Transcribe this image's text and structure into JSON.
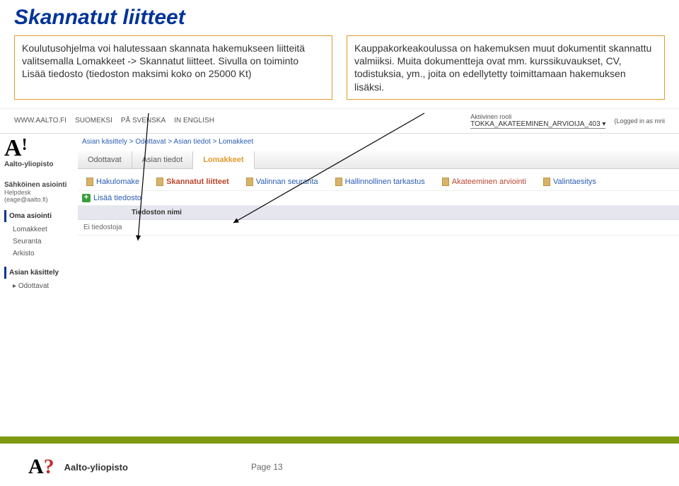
{
  "title": "Skannatut liitteet",
  "callout_left": "Koulutusohjelma voi halutessaan skannata hakemukseen liitteitä valitsemalla Lomakkeet -> Skannatut liitteet. Sivulla on toiminto Lisää tiedosto (tiedoston maksimi koko on 25000 Kt)",
  "callout_right": "Kauppakorkeakoulussa on hakemuksen muut dokumentit skannattu valmiiksi. Muita dokumentteja ovat mm. kurssikuvaukset, CV, todistuksia, ym., joita on edellytetty toimittamaan hakemuksen lisäksi.",
  "toplinks": {
    "url": "WWW.AALTO.FI",
    "langs": [
      "SUOMEKSI",
      "PÅ SVENSKA",
      "IN ENGLISH"
    ],
    "role_label": "Aktiivinen rooli",
    "role_value": "TOKKA_AKATEEMINEN_ARVIOIJA_403",
    "login": "(Logged in as mrii"
  },
  "sidebar": {
    "logo_main": "A",
    "logo_sup": "!",
    "site": "Aalto‑yliopisto",
    "help1": "Sähköinen asiointi",
    "help2": "Helpdesk (eage@aalto.fi)",
    "heads": [
      "Oma asiointi",
      "Asian käsittely"
    ],
    "items_a": [
      "Lomakkeet",
      "Seuranta",
      "Arkisto"
    ],
    "items_b": [
      "Odottavat"
    ]
  },
  "breadcrumb": [
    "Asian käsittely",
    "Odottavat",
    "Asian tiedot",
    "Lomakkeet"
  ],
  "tabs": [
    "Odottavat",
    "Asian tiedot",
    "Lomakkeet"
  ],
  "subtabs": [
    {
      "label": "Hakulomake"
    },
    {
      "label": "Skannatut liitteet"
    },
    {
      "label": "Valinnan seuranta"
    },
    {
      "label": "Hallinnollinen tarkastus"
    },
    {
      "label": "Akateeminen arviointi"
    },
    {
      "label": "Valintaesitys"
    }
  ],
  "add_link": "Lisää tiedosto",
  "table_header": "Tiedoston nimi",
  "no_files": "Ei tiedostoja",
  "footer": {
    "site": "Aalto-yliopisto",
    "page": "Page 13"
  }
}
